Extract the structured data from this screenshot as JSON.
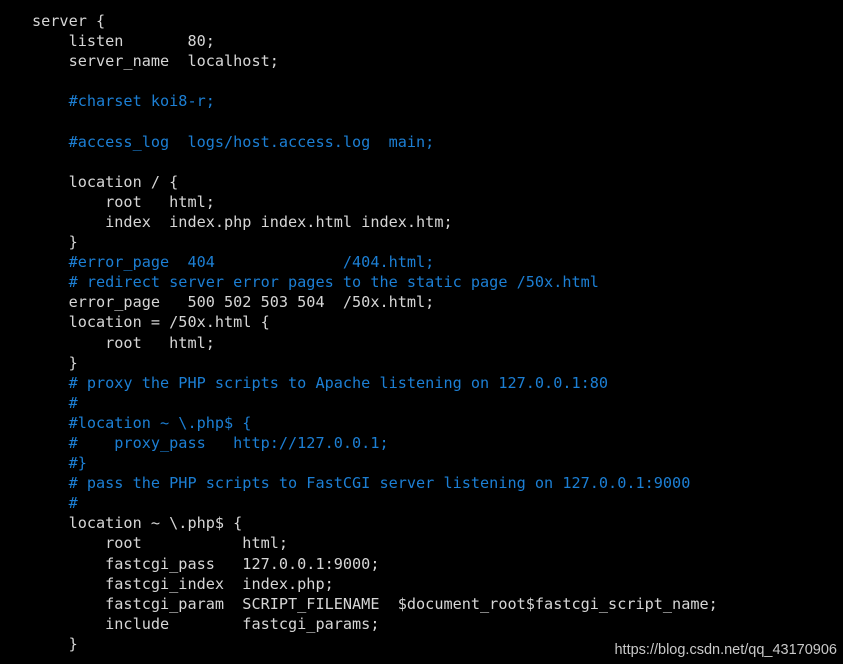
{
  "editor": {
    "background_color": "#000000",
    "text_color": "#d6d6d6",
    "comment_color": "#1c7fd4",
    "lines": [
      {
        "text": "server {",
        "kind": "code"
      },
      {
        "text": "    listen       80;",
        "kind": "code"
      },
      {
        "text": "    server_name  localhost;",
        "kind": "code"
      },
      {
        "text": "",
        "kind": "blank"
      },
      {
        "text": "    #charset koi8-r;",
        "kind": "comment"
      },
      {
        "text": "",
        "kind": "blank"
      },
      {
        "text": "    #access_log  logs/host.access.log  main;",
        "kind": "comment"
      },
      {
        "text": "",
        "kind": "blank"
      },
      {
        "text": "    location / {",
        "kind": "code"
      },
      {
        "text": "        root   html;",
        "kind": "code"
      },
      {
        "text": "        index  index.php index.html index.htm;",
        "kind": "code"
      },
      {
        "text": "    }",
        "kind": "code"
      },
      {
        "text": "    #error_page  404              /404.html;",
        "kind": "comment"
      },
      {
        "text": "    # redirect server error pages to the static page /50x.html",
        "kind": "comment"
      },
      {
        "text": "    error_page   500 502 503 504  /50x.html;",
        "kind": "code"
      },
      {
        "text": "    location = /50x.html {",
        "kind": "code"
      },
      {
        "text": "        root   html;",
        "kind": "code"
      },
      {
        "text": "    }",
        "kind": "code"
      },
      {
        "text": "    # proxy the PHP scripts to Apache listening on 127.0.0.1:80",
        "kind": "comment"
      },
      {
        "text": "    #",
        "kind": "comment"
      },
      {
        "text": "    #location ~ \\.php$ {",
        "kind": "comment"
      },
      {
        "text": "    #    proxy_pass   http://127.0.0.1;",
        "kind": "comment"
      },
      {
        "text": "    #}",
        "kind": "comment"
      },
      {
        "text": "    # pass the PHP scripts to FastCGI server listening on 127.0.0.1:9000",
        "kind": "comment"
      },
      {
        "text": "    #",
        "kind": "comment"
      },
      {
        "text": "    location ~ \\.php$ {",
        "kind": "code"
      },
      {
        "text": "        root           html;",
        "kind": "code"
      },
      {
        "text": "        fastcgi_pass   127.0.0.1:9000;",
        "kind": "code"
      },
      {
        "text": "        fastcgi_index  index.php;",
        "kind": "code"
      },
      {
        "text": "        fastcgi_param  SCRIPT_FILENAME  $document_root$fastcgi_script_name;",
        "kind": "code"
      },
      {
        "text": "        include        fastcgi_params;",
        "kind": "code"
      },
      {
        "text": "    }",
        "kind": "code"
      }
    ]
  },
  "watermark": {
    "text": "https://blog.csdn.net/qq_43170906"
  }
}
